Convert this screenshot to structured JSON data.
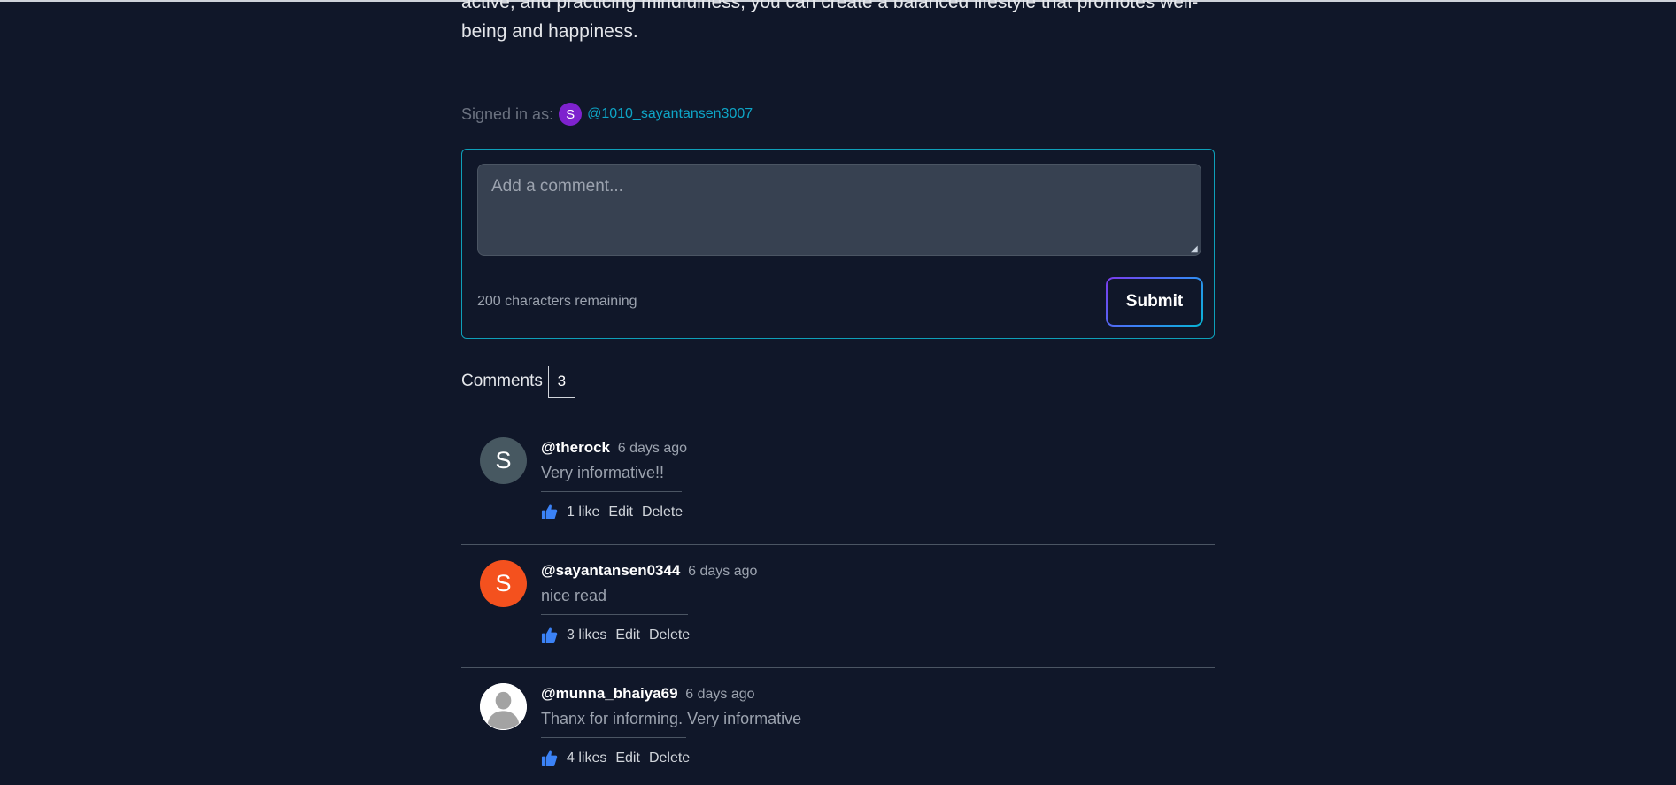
{
  "article": {
    "tail_line_1": "active, and practicing mindfulness, you can create a balanced lifestyle that promotes well-",
    "tail_line_2": "being and happiness."
  },
  "signed_in": {
    "label": "Signed in as:",
    "avatar_letter": "S",
    "avatar_color": "#7e22ce",
    "handle": "@1010_sayantansen3007"
  },
  "comment_form": {
    "placeholder": "Add a comment...",
    "value": "",
    "chars_remaining": "200 characters remaining",
    "submit_label": "Submit"
  },
  "comments_section": {
    "label": "Comments",
    "count": "3"
  },
  "comments": [
    {
      "username": "@therock",
      "time": "6 days ago",
      "text": "Very informative!!",
      "likes": "1 like",
      "edit_label": "Edit",
      "delete_label": "Delete",
      "avatar_letter": "S",
      "avatar_color": "#475861",
      "avatar_icon": "letter-avatar"
    },
    {
      "username": "@sayantansen0344",
      "time": "6 days ago",
      "text": "nice read",
      "likes": "3 likes",
      "edit_label": "Edit",
      "delete_label": "Delete",
      "avatar_letter": "S",
      "avatar_color": "#f4511e",
      "avatar_icon": "letter-avatar"
    },
    {
      "username": "@munna_bhaiya69",
      "time": "6 days ago",
      "text": "Thanx for informing. Very informative",
      "likes": "4 likes",
      "edit_label": "Edit",
      "delete_label": "Delete",
      "avatar_letter": "",
      "avatar_color": "#ffffff",
      "avatar_icon": "default-user-silhouette-icon"
    }
  ],
  "colors": {
    "background": "#101729",
    "accent": "#0ea5c6",
    "like_icon": "#3b82f6"
  }
}
